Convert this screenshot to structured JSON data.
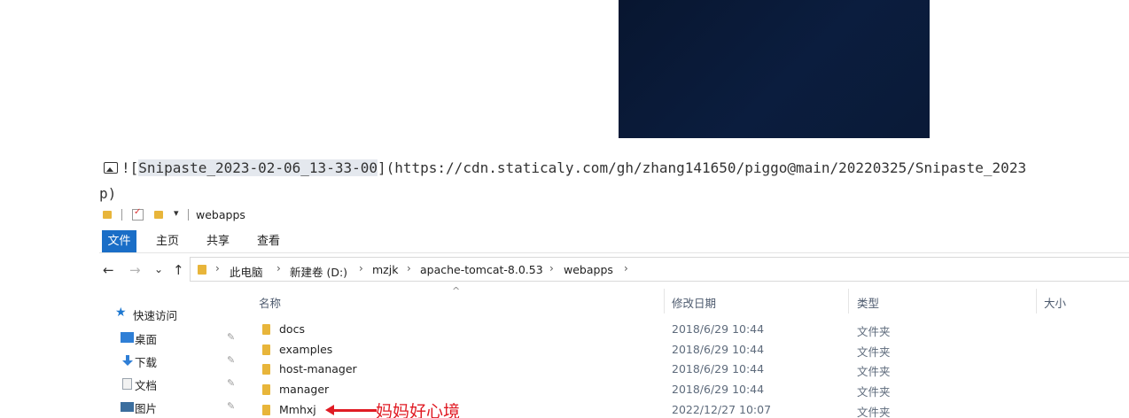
{
  "markdown": {
    "prefix": "![",
    "alt": "Snipaste_2023-02-06_13-33-00",
    "suffix": "](https://cdn.staticaly.com/gh/zhang141650/piggo@main/20220325/Snipaste_2023",
    "wrap": "p)"
  },
  "explorer": {
    "title": "webapps",
    "qa_dropdown": "▾",
    "ribbon_tabs": [
      "文件",
      "主页",
      "共享",
      "查看"
    ],
    "nav": {
      "back": "←",
      "forward": "→",
      "recent": "⌄",
      "up": "↑"
    },
    "breadcrumb": [
      "此电脑",
      "新建卷 (D:)",
      "mzjk",
      "apache-tomcat-8.0.53",
      "webapps"
    ],
    "sort_indicator": "^",
    "columns": [
      "名称",
      "修改日期",
      "类型",
      "大小"
    ],
    "quick_access": "快速访问",
    "sidebar": [
      {
        "label": "桌面",
        "icon": "desktop-icon",
        "pin": "✎"
      },
      {
        "label": "下载",
        "icon": "download-icon",
        "pin": "✎"
      },
      {
        "label": "文档",
        "icon": "document-icon",
        "pin": "✎"
      },
      {
        "label": "图片",
        "icon": "picture-icon",
        "pin": "✎"
      }
    ],
    "files": [
      {
        "name": "docs",
        "date": "2018/6/29 10:44",
        "type": "文件夹"
      },
      {
        "name": "examples",
        "date": "2018/6/29 10:44",
        "type": "文件夹"
      },
      {
        "name": "host-manager",
        "date": "2018/6/29 10:44",
        "type": "文件夹"
      },
      {
        "name": "manager",
        "date": "2018/6/29 10:44",
        "type": "文件夹"
      },
      {
        "name": "Mmhxj",
        "date": "2022/12/27 10:07",
        "type": "文件夹"
      }
    ],
    "annotation": "妈妈好心境"
  },
  "colors": {
    "accent": "#1a6ec7",
    "folder": "#e8b53a",
    "annotation": "#e01b24",
    "dark_image": "#0a1a37"
  }
}
